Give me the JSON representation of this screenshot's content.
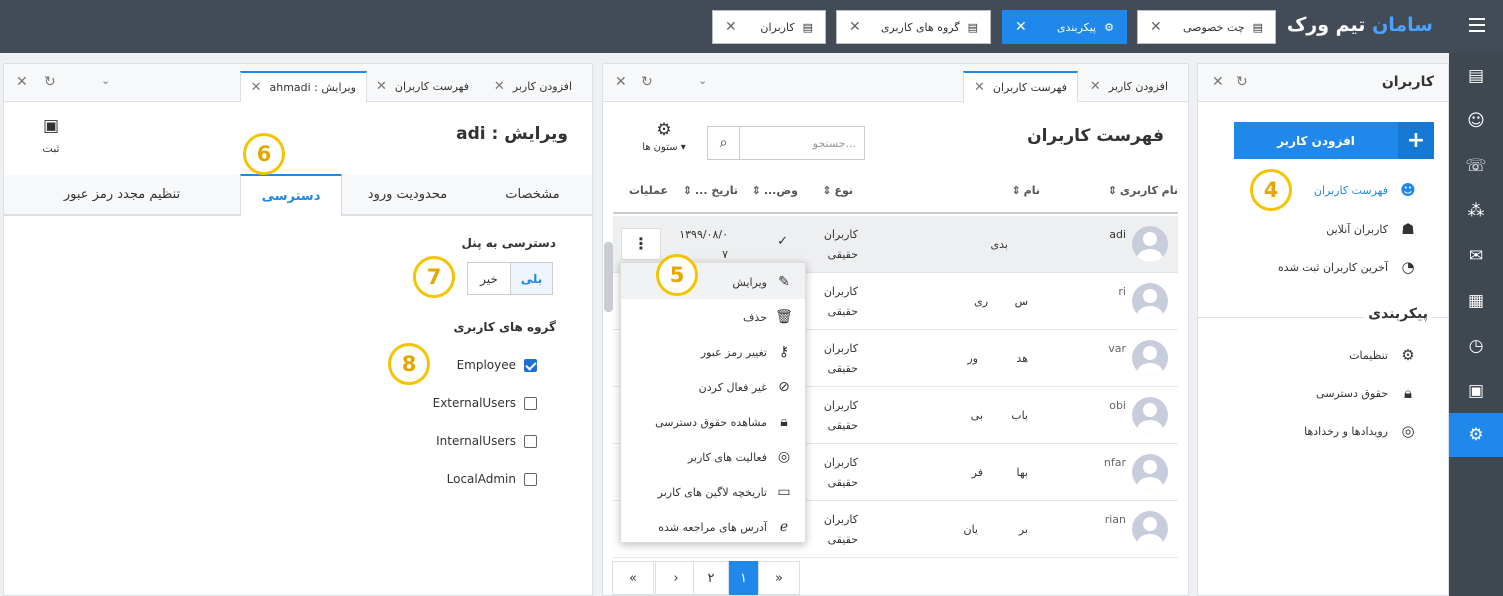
{
  "topbar": {
    "brand_part1": "سامان",
    "brand_part2": "تیم ورک",
    "tabs": [
      {
        "label": "چت خصوصی"
      },
      {
        "label": "پیکربندی"
      },
      {
        "label": "گروه های کاربری"
      },
      {
        "label": "کاربران"
      }
    ]
  },
  "users_panel": {
    "title": "کاربران",
    "add_button": "افزودن کاربر",
    "nav": [
      {
        "label": "فهرست کاربران"
      },
      {
        "label": "کاربران آنلاین"
      },
      {
        "label": "آخرین کاربران ثبت شده"
      }
    ],
    "config_title": "پیکربندی",
    "config_nav": [
      {
        "label": "تنظیمات"
      },
      {
        "label": "حقوق دسترسی"
      },
      {
        "label": "رویدادها و رخدادها"
      }
    ]
  },
  "list_panel": {
    "tabs": [
      {
        "label": "افزودن کاربر"
      },
      {
        "label": "فهرست کاربران"
      }
    ],
    "title": "فهرست کاربران",
    "search_placeholder": "جستجو...",
    "columns_label": "ستون ها",
    "headers": {
      "username": "نام کاربری",
      "name": "نام",
      "type": "نوع",
      "status": "وض...",
      "date": "تاریخ ...",
      "ops": "عملیات"
    },
    "rows": [
      {
        "username": "adi",
        "name": "بدی",
        "type1": "کاربران",
        "type2": "حقیقی",
        "status": "✓",
        "date1": "۱۳۹۹/۰۸/۰",
        "date2": "۷"
      },
      {
        "username": "ri",
        "name": "س",
        "name2": "ری",
        "type1": "کاربران",
        "type2": "حقیقی"
      },
      {
        "username": "var",
        "name": "هد",
        "name2": "ور",
        "type1": "کاربران",
        "type2": "حقیقی"
      },
      {
        "username": "obi",
        "name": "باب",
        "name2": "بی",
        "type1": "کاربران",
        "type2": "حقیقی"
      },
      {
        "username": "nfar",
        "name": "بها",
        "name2": "فر",
        "type1": "کاربران",
        "type2": "حقیقی"
      },
      {
        "username": "rian",
        "name": "بر",
        "name2": "یان",
        "type1": "کاربران",
        "type2": "حقیقی"
      }
    ],
    "menu": [
      {
        "label": "ویرایش"
      },
      {
        "label": "حذف"
      },
      {
        "label": "تغییر رمز عبور"
      },
      {
        "label": "غیر فعال کردن"
      },
      {
        "label": "مشاهده حقوق دسترسی"
      },
      {
        "label": "فعالیت های کاربر"
      },
      {
        "label": "تاریخچه لاگین های کاربر"
      },
      {
        "label": "آدرس های مراجعه شده"
      }
    ],
    "pagination": [
      "«",
      "۱",
      "۲",
      "›",
      "»"
    ]
  },
  "edit_panel": {
    "tabs": [
      {
        "label": "افزودن کاربر"
      },
      {
        "label": "فهرست کاربران"
      },
      {
        "label": "ویرایش : ahmadi"
      }
    ],
    "title": "ویرایش : adi",
    "save_label": "ثبت",
    "form_tabs": [
      {
        "label": "مشخصات"
      },
      {
        "label": "محدودیت ورود"
      },
      {
        "label": "دسترسی"
      },
      {
        "label": "تنظیم مجدد رمز عبور"
      }
    ],
    "panel_access_label": "دسترسی به پنل",
    "yes": "بلی",
    "no": "خیر",
    "groups_label": "گروه های کاربری",
    "groups": [
      {
        "label": "Employee",
        "checked": true
      },
      {
        "label": "ExternalUsers",
        "checked": false
      },
      {
        "label": "InternalUsers",
        "checked": false
      },
      {
        "label": "LocalAdmin",
        "checked": false
      }
    ]
  },
  "badges": [
    "4",
    "5",
    "6",
    "7",
    "8"
  ]
}
